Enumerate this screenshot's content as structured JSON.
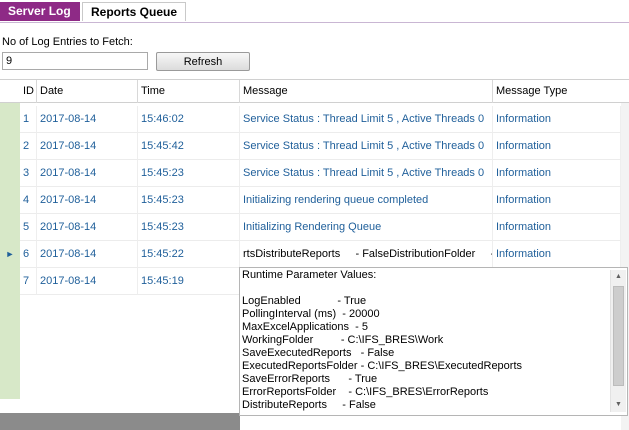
{
  "tabs": [
    {
      "label": "Server Log",
      "active": true
    },
    {
      "label": "Reports Queue",
      "active": false
    }
  ],
  "fetch": {
    "label": "No of Log Entries to Fetch:",
    "value": "9",
    "refresh_label": "Refresh"
  },
  "grid": {
    "columns": [
      "ID",
      "Date",
      "Time",
      "Message",
      "Message Type"
    ],
    "rows": [
      {
        "id": "1",
        "date": "2017-08-14",
        "time": "15:46:02",
        "message": "Service Status : Thread Limit 5 , Active Threads 0",
        "type": "Information"
      },
      {
        "id": "2",
        "date": "2017-08-14",
        "time": "15:45:42",
        "message": "Service Status : Thread Limit 5 , Active Threads 0",
        "type": "Information"
      },
      {
        "id": "3",
        "date": "2017-08-14",
        "time": "15:45:23",
        "message": "Service Status : Thread Limit 5 , Active Threads 0",
        "type": "Information"
      },
      {
        "id": "4",
        "date": "2017-08-14",
        "time": "15:45:23",
        "message": "Initializing rendering queue completed",
        "type": "Information"
      },
      {
        "id": "5",
        "date": "2017-08-14",
        "time": "15:45:23",
        "message": "Initializing Rendering Queue",
        "type": "Information"
      },
      {
        "id": "6",
        "date": "2017-08-14",
        "time": "15:45:22",
        "message": "rtsDistributeReports     - FalseDistributionFolder     -",
        "type": "Information"
      },
      {
        "id": "7",
        "date": "2017-08-14",
        "time": "15:45:19",
        "message": "",
        "type": ""
      }
    ],
    "current_row_indicator": "►"
  },
  "popup": {
    "lines": [
      "Runtime Parameter Values:",
      "",
      "LogEnabled            - True",
      "PollingInterval (ms)  - 20000",
      "MaxExcelApplications  - 5",
      "WorkingFolder         - C:\\IFS_BRES\\Work",
      "SaveExecutedReports   - False",
      "ExecutedReportsFolder - C:\\IFS_BRES\\ExecutedReports",
      "SaveErrorReports      - True",
      "ErrorReportsFolder    - C:\\IFS_BRES\\ErrorReports",
      "DistributeReports     - False"
    ]
  }
}
